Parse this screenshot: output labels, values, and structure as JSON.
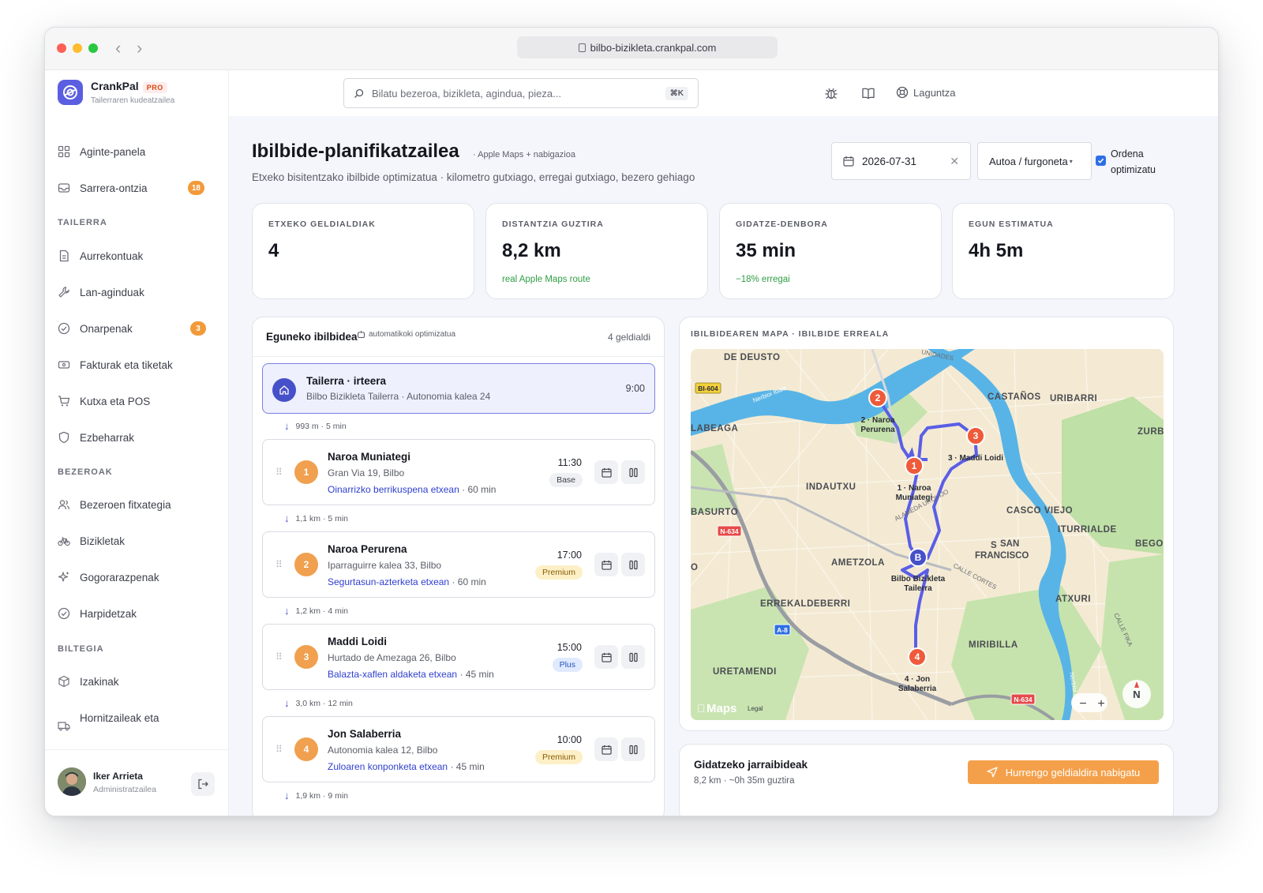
{
  "browser": {
    "url": "bilbo-bizikleta.crankpal.com"
  },
  "brand": {
    "name": "CrankPal",
    "badge": "PRO",
    "subtitle": "Tailerraren kudeatzailea"
  },
  "search": {
    "placeholder": "Bilatu bezeroa, bizikleta, agindua, pieza...",
    "shortcut": "⌘K"
  },
  "topbar": {
    "help_label": "Laguntza"
  },
  "sidebar": {
    "items": [
      {
        "label": "Aginte-panela",
        "icon": "grid-icon"
      },
      {
        "label": "Sarrera-ontzia",
        "icon": "inbox-icon",
        "badge": "18"
      },
      {
        "label": "Aurrekontuak",
        "icon": "document-icon"
      },
      {
        "label": "Lan-aginduak",
        "icon": "wrench-icon"
      },
      {
        "label": "Onarpenak",
        "icon": "check-circle-icon",
        "badge": "3"
      },
      {
        "label": "Fakturak eta tiketak",
        "icon": "ticket-icon"
      },
      {
        "label": "Kutxa eta POS",
        "icon": "cart-icon"
      },
      {
        "label": "Ezbeharrak",
        "icon": "shield-icon"
      },
      {
        "label": "Bezeroen fitxategia",
        "icon": "users-icon"
      },
      {
        "label": "Bizikletak",
        "icon": "bike-icon"
      },
      {
        "label": "Gogorarazpenak",
        "icon": "sparkle-icon"
      },
      {
        "label": "Harpidetzak",
        "icon": "check-circle-icon"
      },
      {
        "label": "Izakinak",
        "icon": "box-icon"
      },
      {
        "label": "Hornitzaileak eta",
        "icon": "truck-icon"
      }
    ],
    "sections": {
      "workshop": "TAILERRA",
      "customers": "BEZEROAK",
      "warehouse": "BILTEGIA"
    }
  },
  "user": {
    "name": "Iker Arrieta",
    "role": "Administratzailea"
  },
  "page": {
    "title": "Ibilbide-planifikatzailea",
    "title_tag": "· Apple Maps + nabigazioa",
    "subtitle": "Etxeko bisitentzako ibilbide optimizatua · kilometro gutxiago, erregai gutxiago, bezero gehiago",
    "date": "2026-07-31",
    "vehicle": "Autoa / furgoneta",
    "optimize_label": "Ordena optimizatu",
    "optimize_checked": true
  },
  "stats": [
    {
      "label": "ETXEKO GELDIALDIAK",
      "value": "4",
      "note": ""
    },
    {
      "label": "DISTANTZIA GUZTIRA",
      "value": "8,2 km",
      "note": "real Apple Maps route"
    },
    {
      "label": "GIDATZE-DENBORA",
      "value": "35 min",
      "note": "−18% erregai"
    },
    {
      "label": "EGUN ESTIMATUA",
      "value": "4h 5m",
      "note": ""
    }
  ],
  "route": {
    "title": "Eguneko ibilbidea",
    "tag": "automatikoki optimizatua",
    "count": "4 geldialdi",
    "depot": {
      "name": "Tailerra · irteera",
      "address": "Bilbo Bizikleta Tailerra · Autonomia kalea 24",
      "time": "9:00"
    },
    "legs": [
      "993 m · 5 min",
      "1,1 km · 5 min",
      "1,2 km · 4 min",
      "3,0 km · 12 min",
      "1,9 km · 9 min"
    ],
    "stops": [
      {
        "num": "1",
        "name": "Naroa Muniategi",
        "address": "Gran Via 19, Bilbo",
        "service": "Oinarrizko berrikuspena etxean",
        "duration": "· 60 min",
        "time": "11:30",
        "plan": "Base"
      },
      {
        "num": "2",
        "name": "Naroa Perurena",
        "address": "Iparraguirre kalea 33, Bilbo",
        "service": "Segurtasun-azterketa etxean",
        "duration": "· 60 min",
        "time": "17:00",
        "plan": "Premium"
      },
      {
        "num": "3",
        "name": "Maddi Loidi",
        "address": "Hurtado de Amezaga 26, Bilbo",
        "service": "Balazta-xaflen aldaketa etxean",
        "duration": "· 45 min",
        "time": "15:00",
        "plan": "Plus"
      },
      {
        "num": "4",
        "name": "Jon Salaberria",
        "address": "Autonomia kalea 12, Bilbo",
        "service": "Zuloaren konponketa etxean",
        "duration": "· 45 min",
        "time": "10:00",
        "plan": "Premium"
      }
    ]
  },
  "map": {
    "label": "IBILBIDEAREN MAPA · IBILBIDE ERREALA",
    "districts": [
      "DE DEUSTO",
      "LABEAGA",
      "CASTAÑOS",
      "URIBARRI",
      "ZURBA",
      "INDAUTXU",
      "BASURTO",
      "CASCO VIEJO",
      "ITURRIALDE",
      "BEGOÑ",
      "SAN FRANCISCO",
      "AMETZOLA",
      "ERREKALDEBERRI",
      "ATXURI",
      "MIRIBILLA",
      "URETAMENDI",
      "O"
    ],
    "streets": [
      "Nerbioi Ibaia",
      "ALAMEDA URQUIJO",
      "CALLE CORTES",
      "CALLE FIKA",
      "Nerbioi Ibaia",
      "UNIDADES"
    ],
    "road_shields": [
      "BI-604",
      "N-634",
      "A-8",
      "N-634"
    ],
    "pins": [
      {
        "num": "2",
        "label": "2 · Naroa Perurena"
      },
      {
        "num": "3",
        "label": "3 · Maddi Loidi"
      },
      {
        "num": "1",
        "label": "1 · Naroa Muniategi"
      },
      {
        "num": "B",
        "label": "Bilbo Bizikleta Tailerra"
      },
      {
        "num": "4",
        "label": "4 · Jon Salaberria"
      }
    ],
    "brand": "Maps",
    "legal": "Legal",
    "zoom_out": "−",
    "zoom_in": "+",
    "compass": "N",
    "colors": {
      "route": "#5a5ee6",
      "pin": "#ee5a3a",
      "depot_pin": "#4650c8",
      "water": "#4fb3e6",
      "park": "#b8dca0"
    }
  },
  "driving": {
    "title": "Gidatzeko jarraibideak",
    "summary": "8,2 km · ~0h 35m guztira",
    "button": "Hurrengo geldialdira nabigatu"
  },
  "colors": {
    "accent": "#5b5ee0",
    "badge": "#f29a3a",
    "stop_number": "#f0a04e",
    "nav_button": "#f4a04a"
  }
}
